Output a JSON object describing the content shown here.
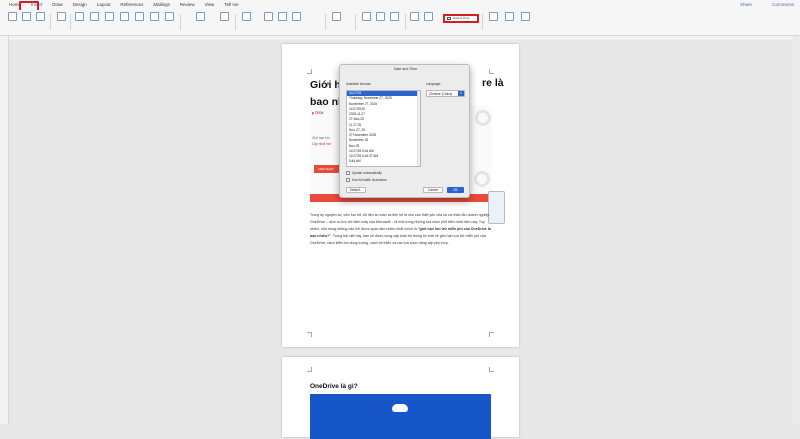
{
  "tabs": [
    "Home",
    "Insert",
    "Draw",
    "Design",
    "Layout",
    "References",
    "Mailings",
    "Review",
    "View",
    "Tell me"
  ],
  "active_tab": "Insert",
  "share_label": "Share",
  "comments_label": "Comments",
  "ribbon": {
    "date_time_label": "Date & Time"
  },
  "document": {
    "title_line1": "Giới hạ",
    "title_line2": "bao nh",
    "title_right": "re là",
    "banner_text1": "Giới hạn lưu",
    "banner_text2": "Cập nhật mới",
    "body_text": "Trong kỷ nguyên số, việc lưu trữ dữ liệu an toàn và tiện lợi là nhu cầu thiết yếu của cả cá nhân lẫn doanh nghiệp. OneDrive – dịch vụ lưu trữ đám mây của Microsoft – là một trong những lựa chọn phổ biến nhất hiện nay. Tuy nhiên, một trong những câu hỏi được quan tâm nhiều nhất chính là",
    "body_bold": "“giới hạn lưu trữ miễn phí của OneDrive là bao nhiêu?”",
    "body_text_end": ". Trong bài viết này, bạn sẽ được cung cấp toàn bộ thông tin mới về giới hạn lưu trữ miễn phí của OneDrive, cách kiểm tra dung lượng, cách tối thiểu và các lựa chọn nâng cấp phù hợp.",
    "section2_head": "OneDrive là gì?"
  },
  "dialog": {
    "title": "Date and Time",
    "formats_label": "Available formats:",
    "language_label": "Language:",
    "language_value": "Chinese (China)",
    "formats": [
      "11/27/25",
      "Thursday, November 27, 2025",
      "November 27, 2025",
      "11/27/2025",
      "2025-11-27",
      "27-Nov-25",
      "11.27.25",
      "Nov. 27, 25",
      "27 November 2025",
      "November 25",
      "Nov-25",
      "11/27/25 5:44 AM",
      "11/27/25 5:44:37 AM",
      "5:44 AM"
    ],
    "selected_index": 0,
    "update_auto_label": "Update automatically",
    "full_width_label": "Use full width characters",
    "default_button": "Default...",
    "cancel_button": "Cancel",
    "ok_button": "OK"
  }
}
